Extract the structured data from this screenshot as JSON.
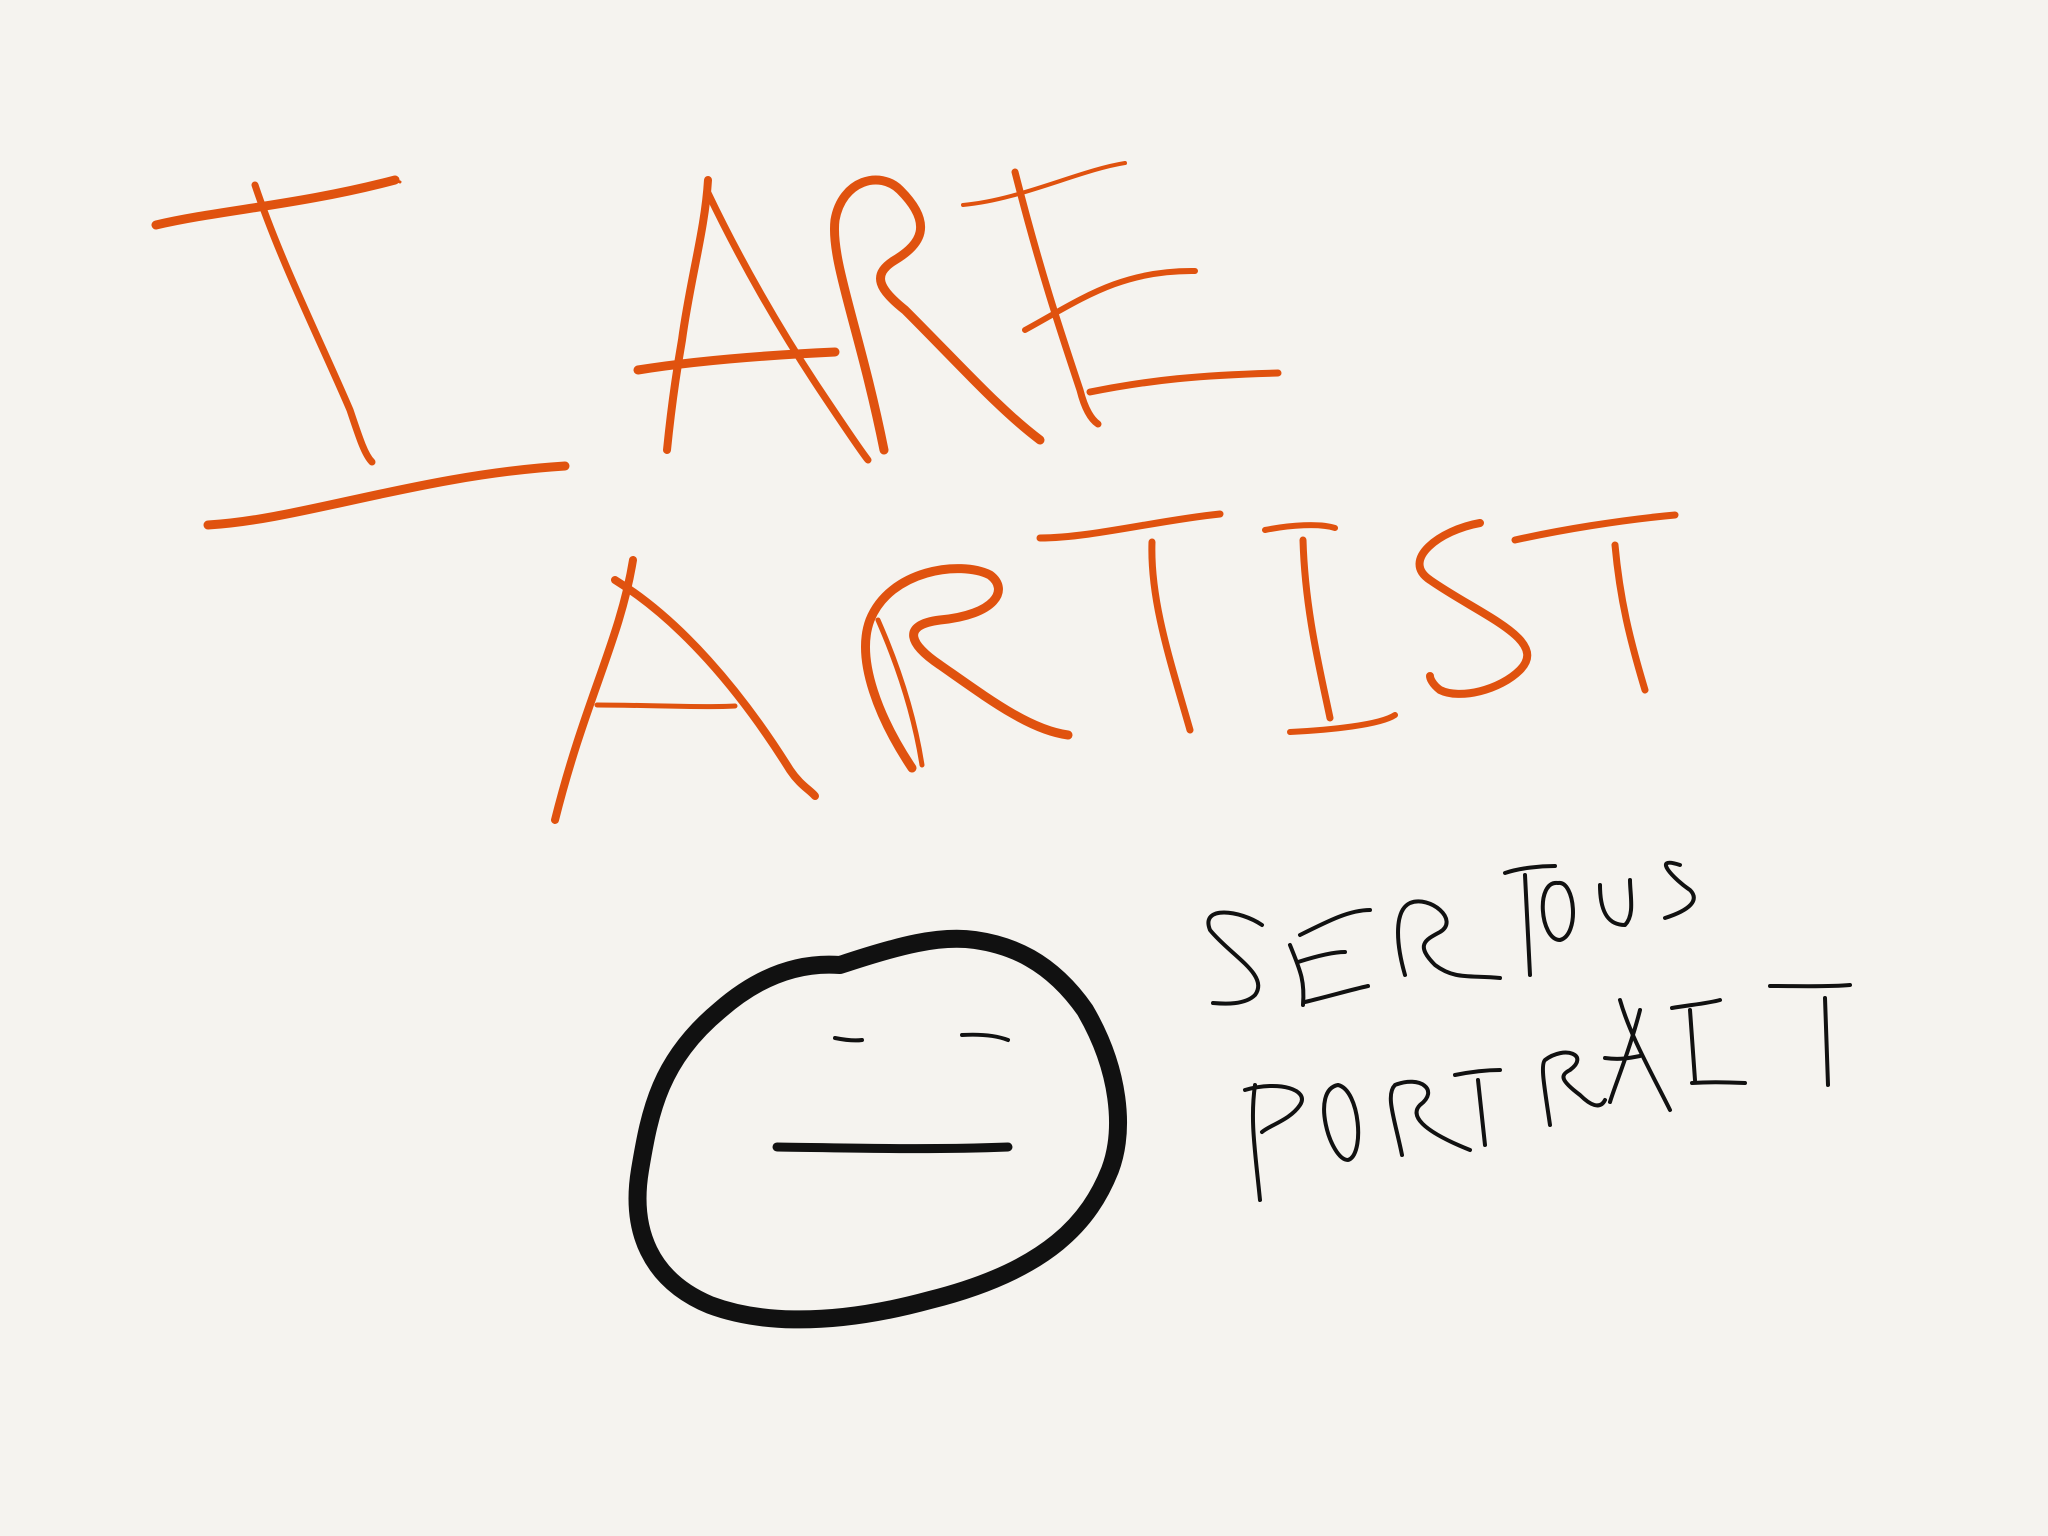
{
  "drawing": {
    "headline_line1": "I ARE",
    "headline_line2": "ARTIST",
    "caption_line1": "SERIOUS",
    "caption_line2": "PORTRAIT"
  },
  "colors": {
    "background": "#f5f3ef",
    "headline": "#e0520f",
    "ink": "#111111"
  }
}
